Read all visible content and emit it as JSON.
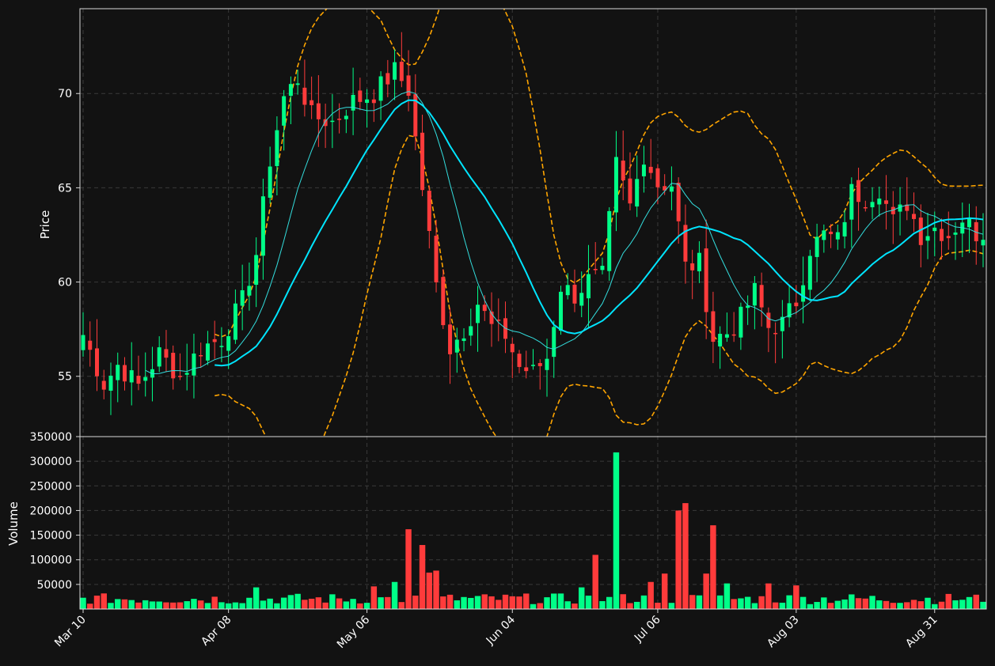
{
  "chart_data": {
    "type": "candlestick",
    "price_panel": {
      "ylabel": "Price",
      "ylim": [
        51.8,
        74.5
      ],
      "yticks": [
        "55",
        "60",
        "65",
        "70"
      ],
      "grid": true
    },
    "volume_panel": {
      "ylabel": "Volume",
      "ylim": [
        0,
        350000
      ],
      "yticks": [
        "50000",
        "100000",
        "150000",
        "200000",
        "250000",
        "300000",
        "350000"
      ],
      "grid": true
    },
    "xticks": [
      {
        "label": "Mar 10",
        "index": 0
      },
      {
        "label": "Apr 08",
        "index": 21
      },
      {
        "label": "May 06",
        "index": 41
      },
      {
        "label": "Jun 04",
        "index": 62
      },
      {
        "label": "Jul 06",
        "index": 83
      },
      {
        "label": "Aug 03",
        "index": 103
      },
      {
        "label": "Aug 31",
        "index": 123
      }
    ],
    "up_color": "#00ff88",
    "down_color": "#ff3b3b",
    "ma_fast_color": "#33dddd",
    "ma_slow_color": "#00e5ff",
    "band_color": "#ffa500",
    "anchors": [
      {
        "i": 0,
        "c": 57.2
      },
      {
        "i": 3,
        "c": 54.6
      },
      {
        "i": 5,
        "c": 55.6
      },
      {
        "i": 8,
        "c": 54.5
      },
      {
        "i": 11,
        "c": 56.2
      },
      {
        "i": 14,
        "c": 55.0
      },
      {
        "i": 17,
        "c": 56.5
      },
      {
        "i": 20,
        "c": 57.0
      },
      {
        "i": 23,
        "c": 59.0
      },
      {
        "i": 25,
        "c": 61.5
      },
      {
        "i": 27,
        "c": 66.5
      },
      {
        "i": 29,
        "c": 69.8
      },
      {
        "i": 31,
        "c": 70.8
      },
      {
        "i": 33,
        "c": 68.8
      },
      {
        "i": 36,
        "c": 68.5
      },
      {
        "i": 39,
        "c": 69.6
      },
      {
        "i": 42,
        "c": 70.0
      },
      {
        "i": 45,
        "c": 71.2
      },
      {
        "i": 47,
        "c": 70.2
      },
      {
        "i": 49,
        "c": 65.0
      },
      {
        "i": 51,
        "c": 59.8
      },
      {
        "i": 53,
        "c": 56.5
      },
      {
        "i": 55,
        "c": 57.5
      },
      {
        "i": 57,
        "c": 58.9
      },
      {
        "i": 59,
        "c": 57.6
      },
      {
        "i": 61,
        "c": 57.2
      },
      {
        "i": 63,
        "c": 55.5
      },
      {
        "i": 65,
        "c": 55.2
      },
      {
        "i": 67,
        "c": 56.0
      },
      {
        "i": 69,
        "c": 59.8
      },
      {
        "i": 71,
        "c": 59.3
      },
      {
        "i": 73,
        "c": 60.1
      },
      {
        "i": 75,
        "c": 60.3
      },
      {
        "i": 77,
        "c": 66.2
      },
      {
        "i": 79,
        "c": 64.0
      },
      {
        "i": 81,
        "c": 66.8
      },
      {
        "i": 83,
        "c": 65.2
      },
      {
        "i": 85,
        "c": 65.2
      },
      {
        "i": 87,
        "c": 60.8
      },
      {
        "i": 89,
        "c": 61.0
      },
      {
        "i": 91,
        "c": 57.0
      },
      {
        "i": 93,
        "c": 57.3
      },
      {
        "i": 95,
        "c": 58.1
      },
      {
        "i": 97,
        "c": 59.5
      },
      {
        "i": 99,
        "c": 57.6
      },
      {
        "i": 101,
        "c": 57.8
      },
      {
        "i": 103,
        "c": 59.0
      },
      {
        "i": 105,
        "c": 61.8
      },
      {
        "i": 107,
        "c": 62.5
      },
      {
        "i": 109,
        "c": 62.2
      },
      {
        "i": 111,
        "c": 64.8
      },
      {
        "i": 113,
        "c": 64.5
      },
      {
        "i": 115,
        "c": 65.0
      },
      {
        "i": 117,
        "c": 63.2
      },
      {
        "i": 119,
        "c": 64.2
      },
      {
        "i": 121,
        "c": 62.5
      },
      {
        "i": 123,
        "c": 62.9
      },
      {
        "i": 125,
        "c": 62.5
      },
      {
        "i": 127,
        "c": 63.4
      },
      {
        "i": 129,
        "c": 62.6
      }
    ],
    "volume_peaks": [
      {
        "i": 47,
        "v": 162000
      },
      {
        "i": 49,
        "v": 130000
      },
      {
        "i": 50,
        "v": 74000
      },
      {
        "i": 51,
        "v": 78000
      },
      {
        "i": 74,
        "v": 110000
      },
      {
        "i": 77,
        "v": 318000
      },
      {
        "i": 82,
        "v": 55000
      },
      {
        "i": 84,
        "v": 72000
      },
      {
        "i": 86,
        "v": 200000
      },
      {
        "i": 87,
        "v": 215000
      },
      {
        "i": 90,
        "v": 72000
      },
      {
        "i": 91,
        "v": 170000
      },
      {
        "i": 93,
        "v": 52000
      },
      {
        "i": 99,
        "v": 52000
      },
      {
        "i": 103,
        "v": 48000
      },
      {
        "i": 45,
        "v": 55000
      },
      {
        "i": 25,
        "v": 44000
      },
      {
        "i": 42,
        "v": 46000
      },
      {
        "i": 72,
        "v": 44000
      }
    ],
    "volume_base": 22000
  }
}
